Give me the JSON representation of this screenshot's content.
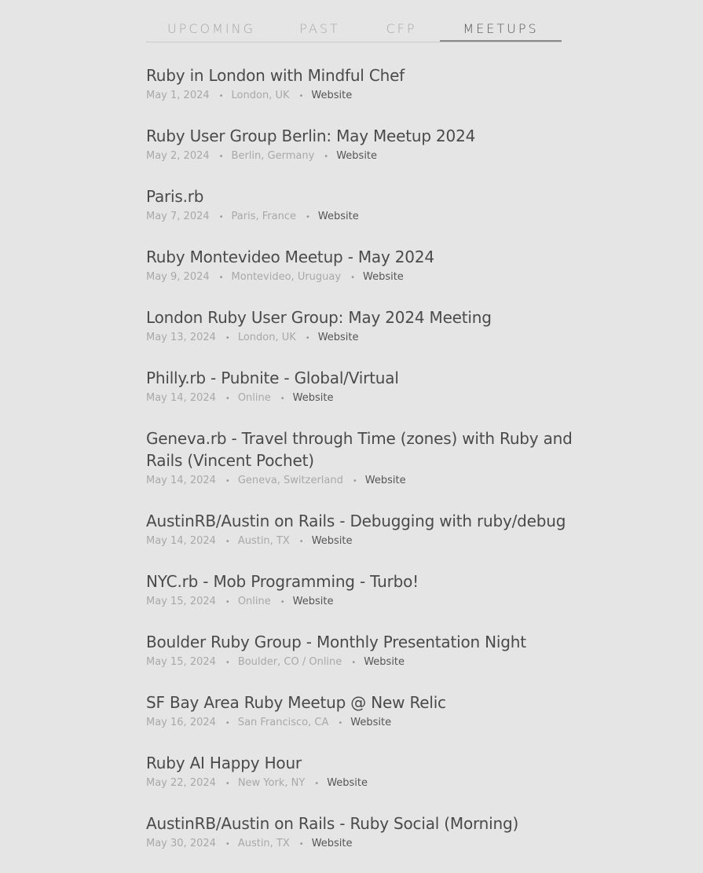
{
  "tabs": [
    {
      "label": "UPCOMING",
      "active": false
    },
    {
      "label": "PAST",
      "active": false
    },
    {
      "label": "CFP",
      "active": false
    },
    {
      "label": "MEETUPS",
      "active": true
    }
  ],
  "separator": "•",
  "meetups": [
    {
      "title": "Ruby in London with Mindful Chef",
      "date": "May 1, 2024",
      "location": "London, UK",
      "link": "Website"
    },
    {
      "title": "Ruby User Group Berlin: May Meetup 2024",
      "date": "May 2, 2024",
      "location": "Berlin, Germany",
      "link": "Website"
    },
    {
      "title": "Paris.rb",
      "date": "May 7, 2024",
      "location": "Paris, France",
      "link": "Website"
    },
    {
      "title": "Ruby Montevideo Meetup - May 2024",
      "date": "May 9, 2024",
      "location": "Montevideo, Uruguay",
      "link": "Website"
    },
    {
      "title": "London Ruby User Group: May 2024 Meeting",
      "date": "May 13, 2024",
      "location": "London, UK",
      "link": "Website"
    },
    {
      "title": "Philly.rb - Pubnite - Global/Virtual",
      "date": "May 14, 2024",
      "location": "Online",
      "link": "Website"
    },
    {
      "title": "Geneva.rb - Travel through Time (zones) with Ruby and Rails (Vincent Pochet)",
      "date": "May 14, 2024",
      "location": "Geneva, Switzerland",
      "link": "Website"
    },
    {
      "title": "AustinRB/Austin on Rails - Debugging with ruby/debug",
      "date": "May 14, 2024",
      "location": "Austin, TX",
      "link": "Website"
    },
    {
      "title": "NYC.rb - Mob Programming - Turbo!",
      "date": "May 15, 2024",
      "location": "Online",
      "link": "Website"
    },
    {
      "title": "Boulder Ruby Group - Monthly Presentation Night",
      "date": "May 15, 2024",
      "location": "Boulder, CO / Online",
      "link": "Website"
    },
    {
      "title": "SF Bay Area Ruby Meetup @ New Relic",
      "date": "May 16, 2024",
      "location": "San Francisco, CA",
      "link": "Website"
    },
    {
      "title": "Ruby AI Happy Hour",
      "date": "May 22, 2024",
      "location": "New York, NY",
      "link": "Website"
    },
    {
      "title": "AustinRB/Austin on Rails - Ruby Social (Morning)",
      "date": "May 30, 2024",
      "location": "Austin, TX",
      "link": "Website"
    }
  ]
}
